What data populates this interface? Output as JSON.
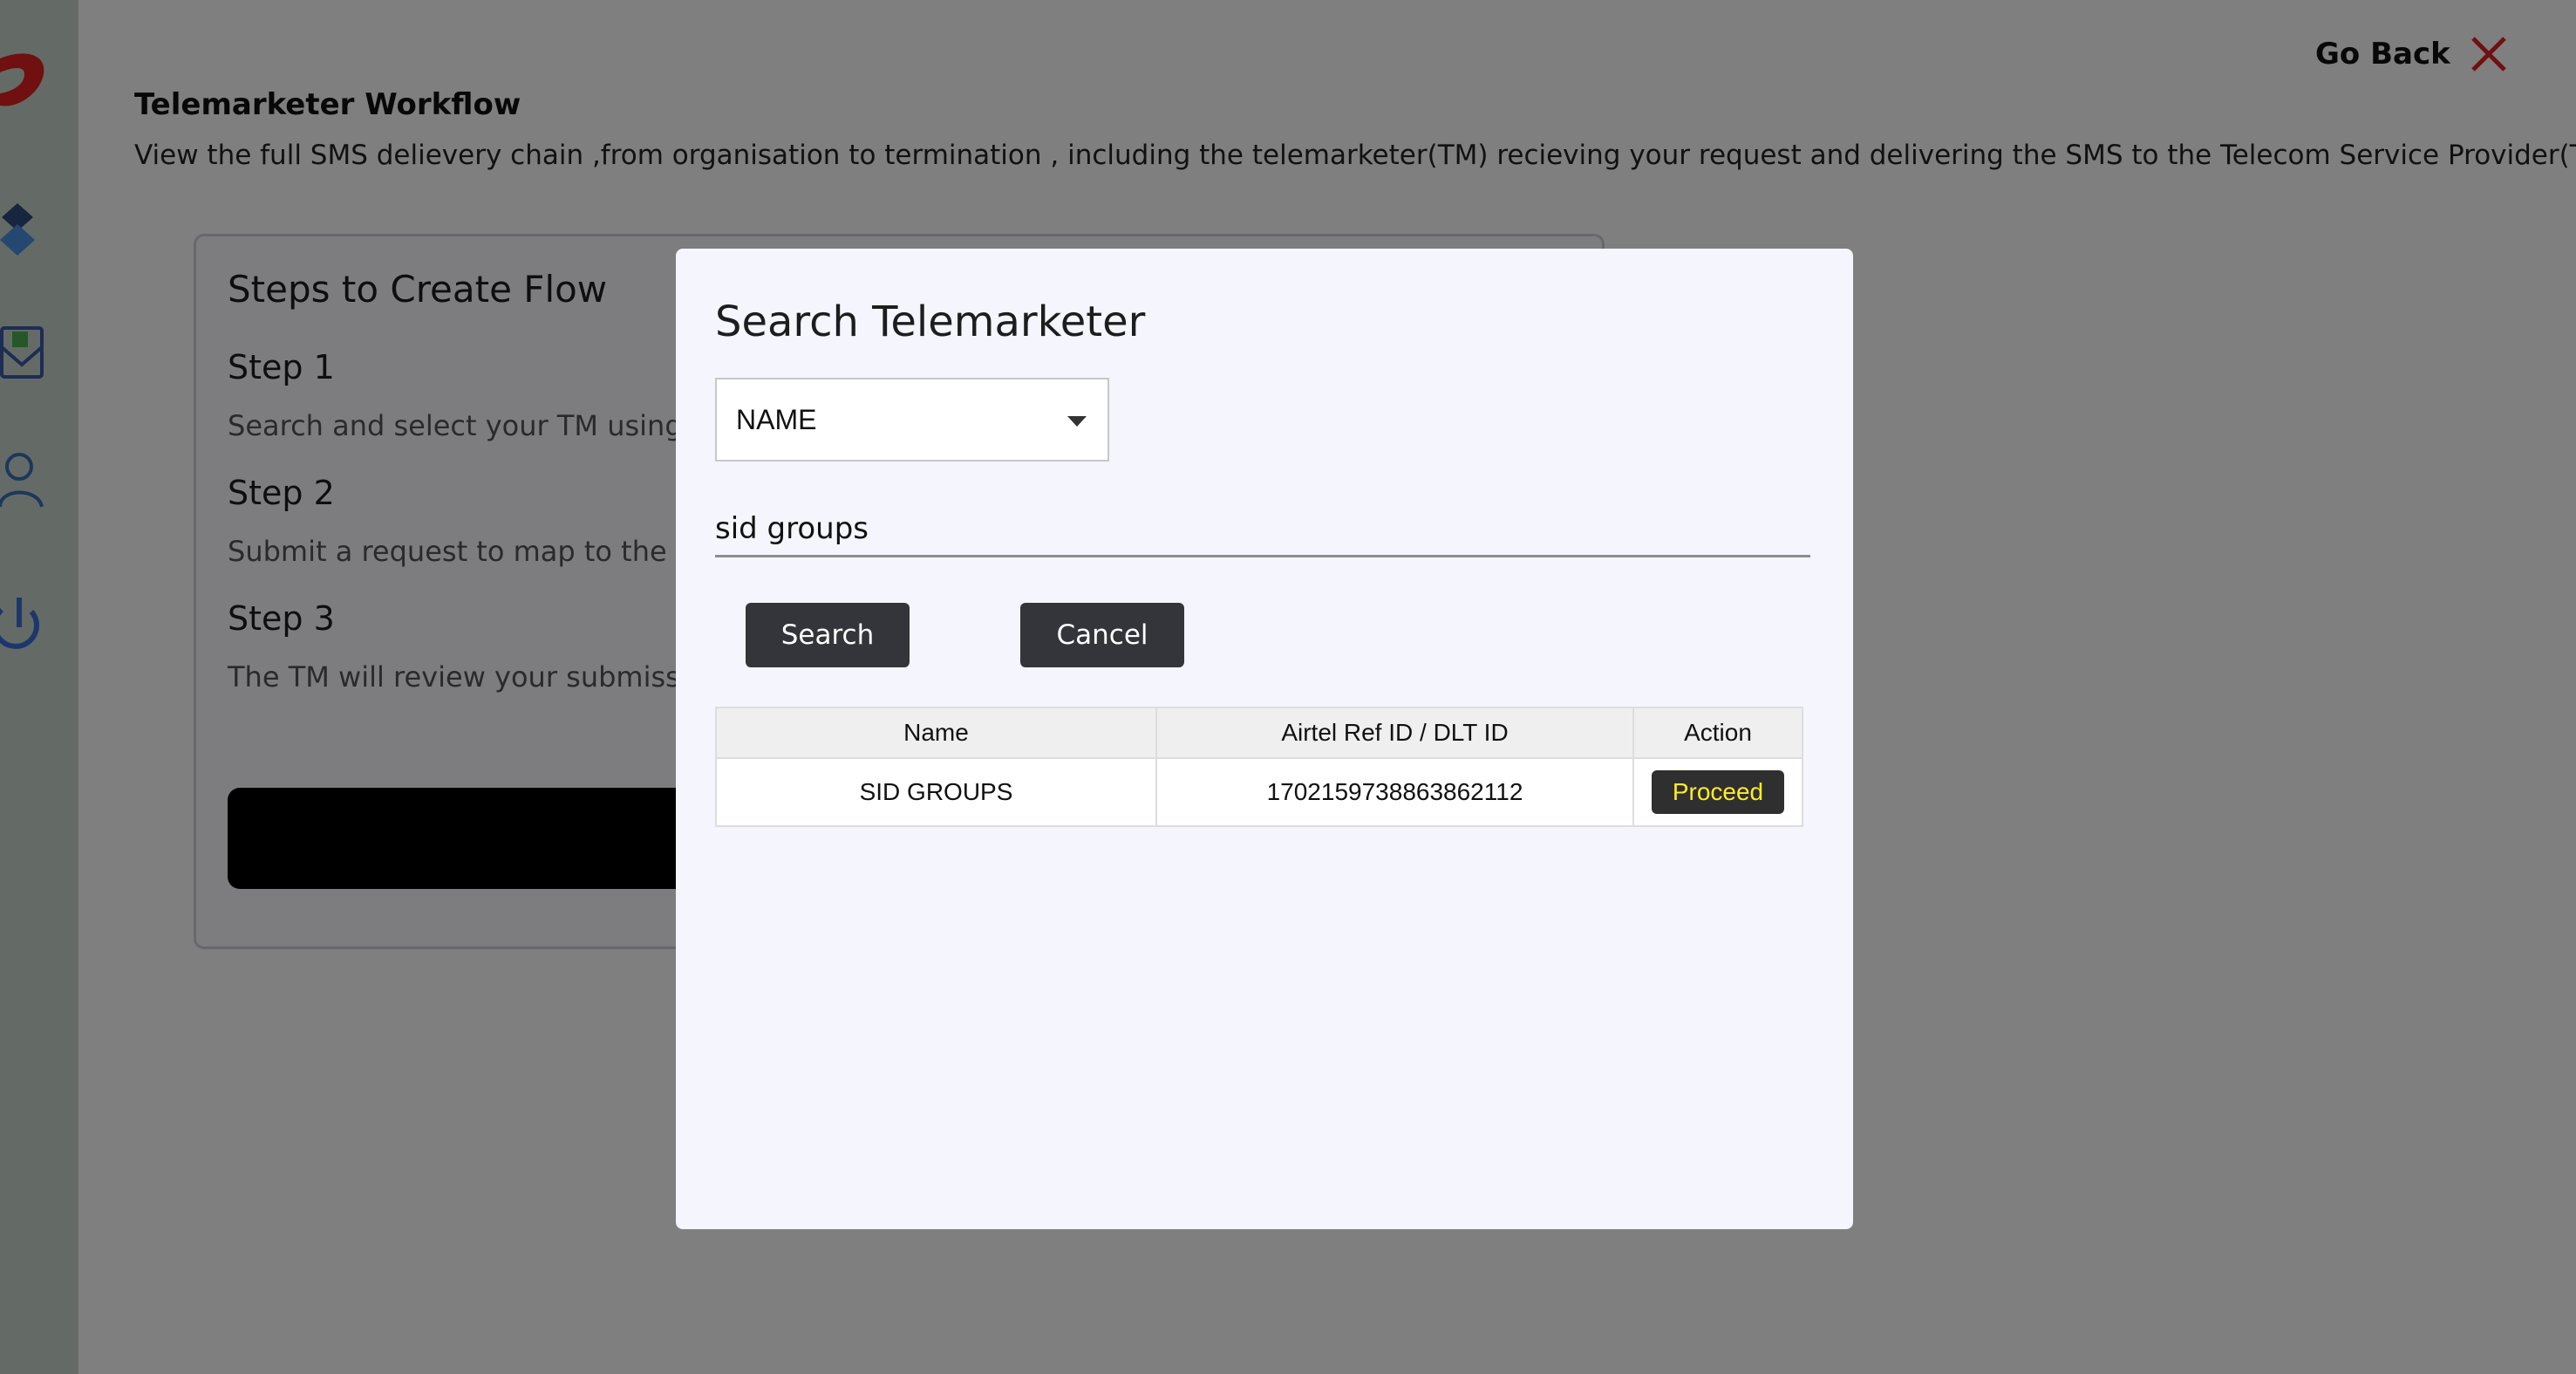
{
  "page": {
    "go_back_label": "Go Back",
    "title": "Telemarketer Workflow",
    "description": "View the full SMS delievery chain ,from organisation to termination , including the telemarketer(TM) recieving your request and delivering the SMS to the Telecom Service Provider(TSP) ."
  },
  "steps_card": {
    "title": "Steps to Create Flow",
    "steps": [
      {
        "heading": "Step 1",
        "text": "Search and select your TM using"
      },
      {
        "heading": "Step 2",
        "text": "Submit a request to map to the c"
      },
      {
        "heading": "Step 3",
        "text": "The TM will review your submiss"
      }
    ]
  },
  "sidebar": {
    "icons": [
      "brand-logo-icon",
      "templates-icon",
      "message-icon",
      "user-icon",
      "power-icon"
    ]
  },
  "modal": {
    "title": "Search Telemarketer",
    "search_type": {
      "selected": "NAME"
    },
    "search_value": "sid groups",
    "search_button": "Search",
    "cancel_button": "Cancel",
    "table": {
      "headers": [
        "Name",
        "Airtel Ref ID / DLT ID",
        "Action"
      ],
      "rows": [
        {
          "name": "SID GROUPS",
          "ref_id": "1702159738863862112",
          "action": "Proceed"
        }
      ]
    }
  },
  "colors": {
    "brand_red": "#e02020",
    "dark_button": "#34353a",
    "proceed_text": "#ffeb2a",
    "overlay": "rgba(0,0,0,0.5)"
  }
}
